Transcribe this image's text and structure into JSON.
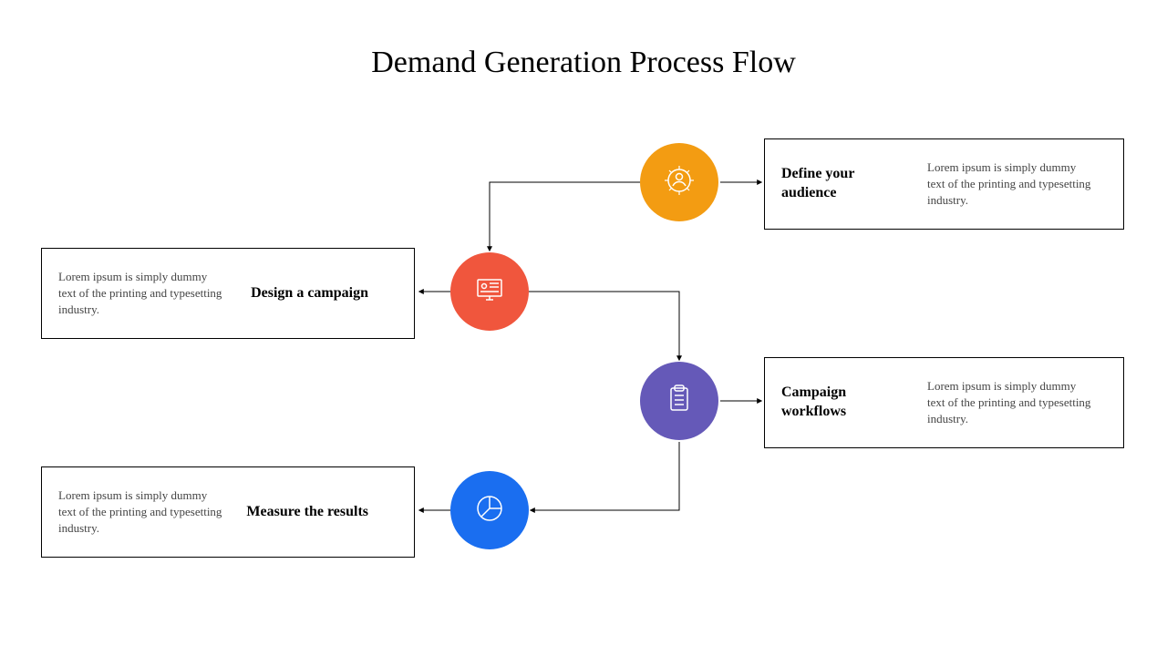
{
  "title": "Demand Generation Process Flow",
  "steps": [
    {
      "id": "define-audience",
      "title": "Define your audience",
      "desc": "Lorem ipsum is simply dummy text of the printing and typesetting industry.",
      "color": "#f39c12",
      "icon": "gear-user"
    },
    {
      "id": "design-campaign",
      "title": "Design a campaign",
      "desc": "Lorem ipsum is simply dummy text of the printing and typesetting industry.",
      "color": "#f0563d",
      "icon": "monitor"
    },
    {
      "id": "campaign-workflows",
      "title": "Campaign workflows",
      "desc": "Lorem ipsum is simply dummy text of the printing and typesetting industry.",
      "color": "#6559b8",
      "icon": "clipboard"
    },
    {
      "id": "measure-results",
      "title": "Measure the results",
      "desc": "Lorem ipsum is simply dummy text of the printing and typesetting industry.",
      "color": "#1a6ef0",
      "icon": "pie"
    }
  ]
}
